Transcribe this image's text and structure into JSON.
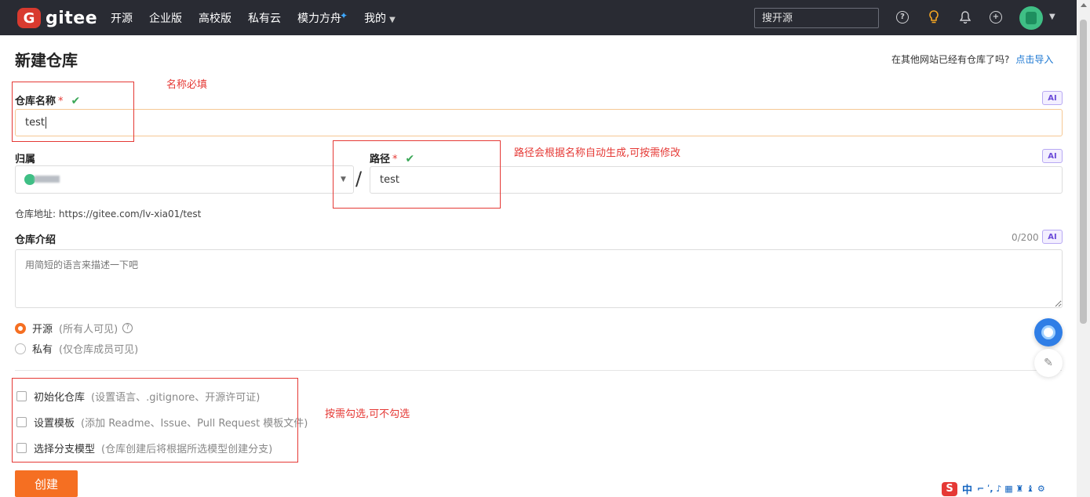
{
  "nav": {
    "logo_letter": "G",
    "logo_text": "gitee",
    "links": [
      {
        "label": "开源"
      },
      {
        "label": "企业版"
      },
      {
        "label": "高校版"
      },
      {
        "label": "私有云"
      },
      {
        "label": "模力方舟"
      },
      {
        "label": "我的"
      }
    ],
    "search_placeholder": "搜开源",
    "icons": [
      "help-icon",
      "lightbulb-icon",
      "bell-icon",
      "plus-circle-icon",
      "avatar"
    ]
  },
  "page": {
    "title": "新建仓库",
    "import_hint": "在其他网站已经有仓库了吗?",
    "import_link": "点击导入"
  },
  "form": {
    "name_label": "仓库名称",
    "name_value": "test",
    "owner_label": "归属",
    "path_label": "路径",
    "path_value": "test",
    "separator": "/",
    "address": "仓库地址: https://gitee.com/lv-xia01/test",
    "intro_label": "仓库介绍",
    "intro_counter": "0/200",
    "intro_placeholder": "用简短的语言来描述一下吧",
    "ai_label": "AI",
    "required_mark": "*",
    "check_mark": "✔"
  },
  "visibility": {
    "public_label": "开源",
    "public_hint": "(所有人可见)",
    "private_label": "私有",
    "private_hint": "(仅仓库成员可见)",
    "selected": "public"
  },
  "options": [
    {
      "label": "初始化仓库",
      "hint": "(设置语言、.gitignore、开源许可证)"
    },
    {
      "label": "设置模板",
      "hint": "(添加 Readme、Issue、Pull Request 模板文件)"
    },
    {
      "label": "选择分支模型",
      "hint": "(仓库创建后将根据所选模型创建分支)"
    }
  ],
  "annotations": {
    "name_note": "名称必填",
    "path_note": "路径会根据名称自动生成,可按需修改",
    "options_note": "按需勾选,可不勾选"
  },
  "create_label": "创建",
  "ime": {
    "logo": "S",
    "mode": "中",
    "tail": "⌐ ʹ, ♪ ▦ ♜ ♝ ⚙"
  },
  "colors": {
    "accent": "#f56f22",
    "nav_bg": "#292b33",
    "annotation": "#e53935",
    "link": "#1976d2"
  }
}
